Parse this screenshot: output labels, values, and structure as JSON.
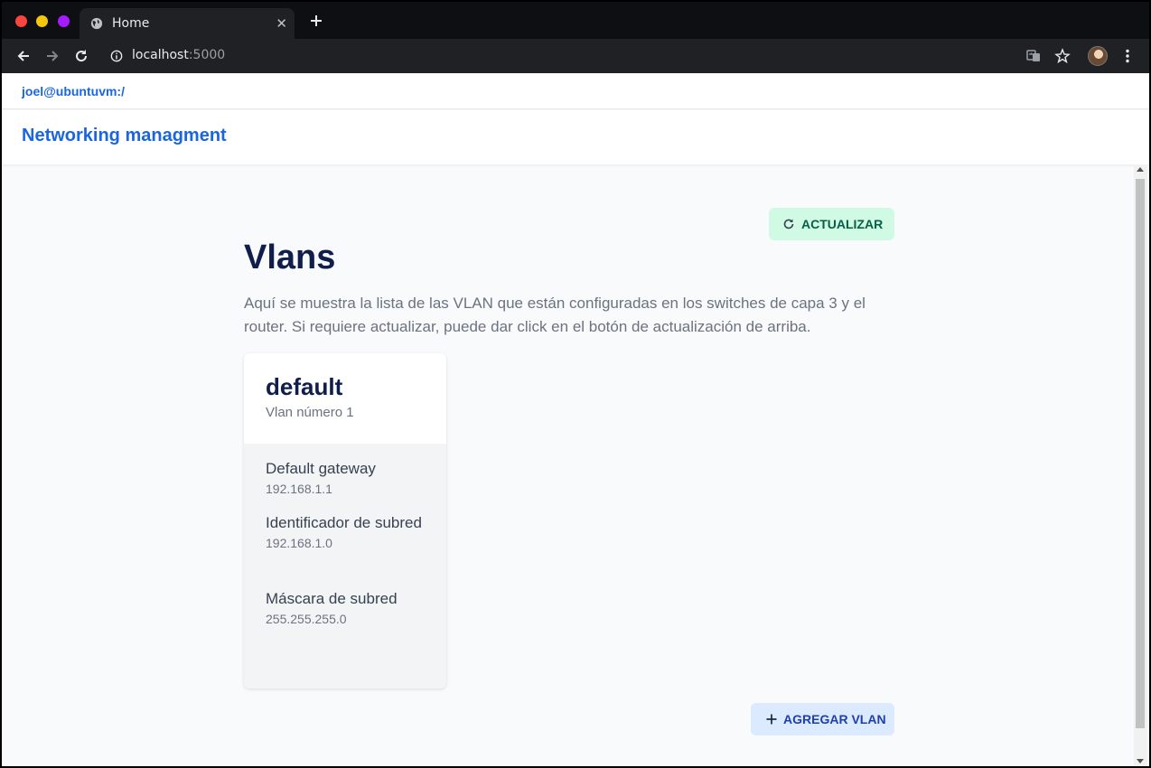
{
  "browser": {
    "tab_title": "Home",
    "url_host": "localhost",
    "url_port": ":5000"
  },
  "app": {
    "path": "joel@ubuntuvm:/",
    "brand": "Networking managment"
  },
  "main": {
    "refresh_label": "ACTUALIZAR",
    "title": "Vlans",
    "description": "Aquí se muestra la lista de las VLAN que están configuradas en los switches de capa 3 y el router. Si requiere actualizar, puede dar click en el botón de actualización de arriba.",
    "add_label": "AGREGAR VLAN"
  },
  "vlans": [
    {
      "name": "default",
      "subtitle": "Vlan número 1",
      "fields": [
        {
          "label": "Default gateway",
          "value": "192.168.1.1"
        },
        {
          "label": "Identificador de subred",
          "value": "192.168.1.0"
        },
        {
          "label": "Máscara de subred",
          "value": "255.255.255.0"
        }
      ]
    }
  ],
  "colors": {
    "brand": "#1a66e0",
    "title": "#0f1e4a",
    "refresh_bg": "#d1fae5",
    "add_bg": "#dbeafe"
  }
}
